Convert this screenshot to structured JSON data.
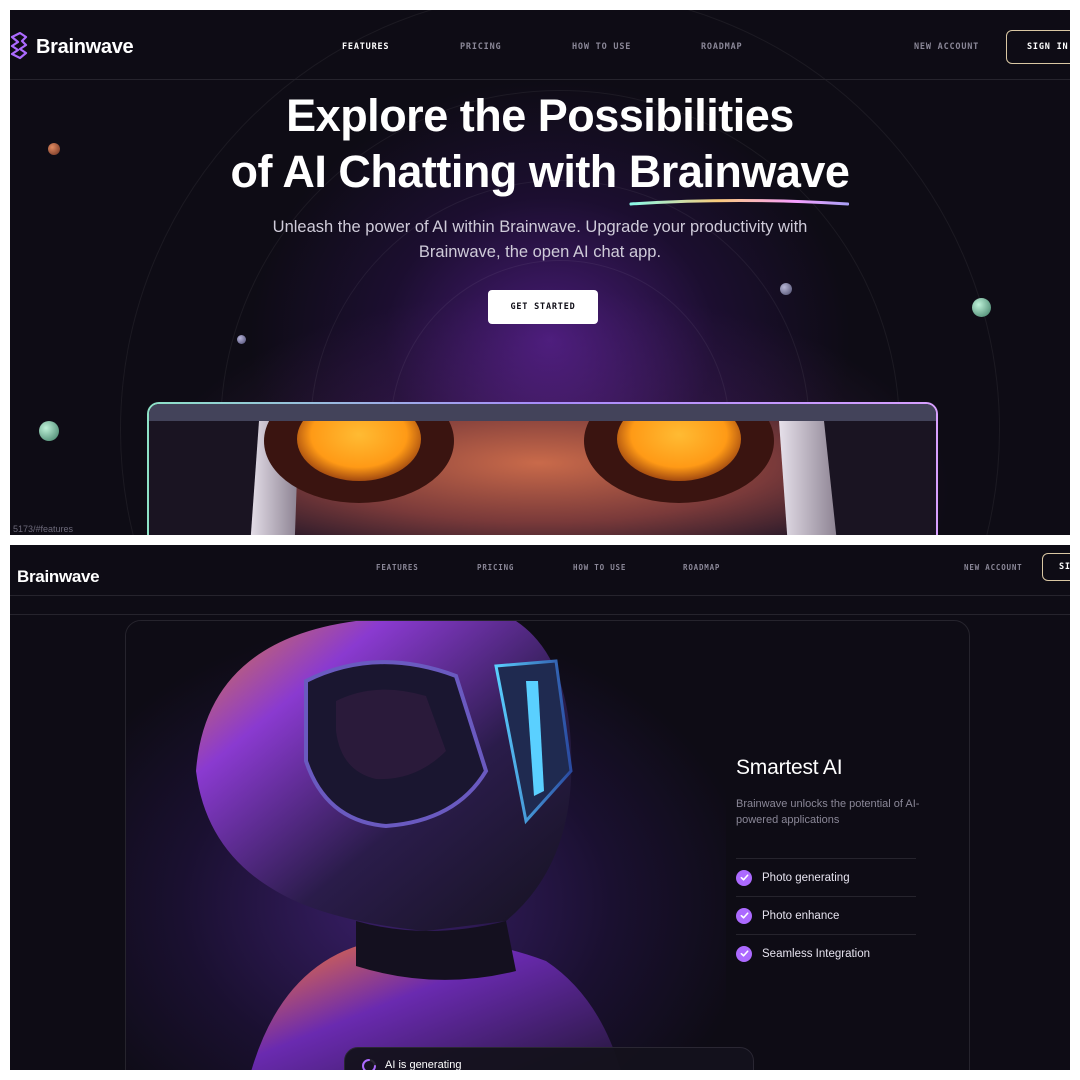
{
  "nav": {
    "logo": "Brainwave",
    "links": [
      "FEATURES",
      "PRICING",
      "HOW TO USE",
      "ROADMAP"
    ],
    "active_link": "FEATURES",
    "new_account": "NEW ACCOUNT",
    "sign_in": "SIGN IN",
    "sign_in_cropped": "SI"
  },
  "hero": {
    "title_line1": "Explore the Possibilities",
    "title_line2_prefix": "of AI Chatting with ",
    "title_brand": "Brainwave",
    "subtitle_line1": "Unleash the power of AI within Brainwave. Upgrade your productivity with",
    "subtitle_line2": "Brainwave, the open AI chat app.",
    "cta": "GET STARTED"
  },
  "status_bar": {
    "url": "5173/#features"
  },
  "feature": {
    "title": "Smartest AI",
    "description": "Brainwave unlocks the potential of AI-powered applications",
    "items": [
      "Photo generating",
      "Photo enhance",
      "Seamless Integration"
    ],
    "generating_label": "AI is generating"
  },
  "colors": {
    "background": "#0e0c15",
    "accent_purple": "#ac6aff",
    "sign_in_border": "#d9c7a3",
    "text_muted": "#8a8797"
  },
  "icons": {
    "logo": "brainwave-logo-icon",
    "check": "check-icon",
    "loader": "loader-icon"
  }
}
